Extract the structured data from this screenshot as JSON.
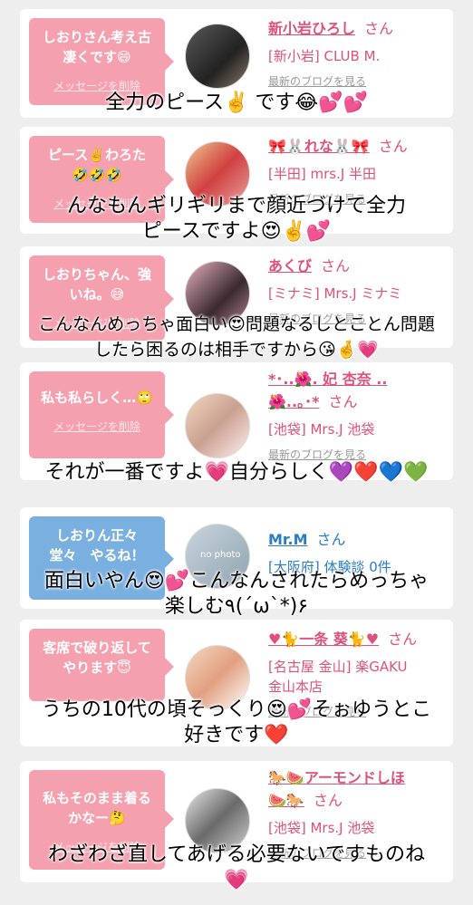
{
  "cards": [
    {
      "message": "しおりさん考え古\n凄くです😄",
      "delete_label": "メッセージを削除",
      "name": "新小岩ひろし",
      "san": "さん",
      "shop": "[新小岩] CLUB M.",
      "blog": "最新のブログを見る",
      "avatar": "avatar-photo"
    },
    {
      "message": "ピース✌️わろた\n🤣🤣🤣",
      "delete_label": "メッセージを削除",
      "name": "🎀🐰れな🐰🎀",
      "san": "さん",
      "shop": "[半田] mrs.J 半田",
      "blog": "最新のブログを見る",
      "avatar": "avatar-photo"
    },
    {
      "message": "しおりちゃん、強\nいね。😅",
      "delete_label": "メッセージを削除",
      "name": "あくび",
      "san": "さん",
      "shop": "[ミナミ] Mrs.J ミナミ",
      "blog": "最新のブログを見る",
      "avatar": "avatar-photo"
    },
    {
      "message": "私も私らしく…🙄",
      "delete_label": "メッセージを削除",
      "name": "*･..🌺. 妃 杏奈 ..\n🌺..｡･*",
      "san": "さん",
      "shop": "[池袋] Mrs.J 池袋",
      "blog": "最新のブログを見る",
      "avatar": "avatar-photo"
    },
    {
      "message": "しおりん正々\n堂々　やるね！",
      "delete_label": "",
      "name": "Mr.M",
      "san": "さん",
      "shop": "[大阪府] 体験談 0件",
      "blog": "",
      "avatar": "no photo"
    },
    {
      "message": "客席で破り返して\nやります😇",
      "delete_label": "",
      "name": "♥🐈一条 葵🐈♥",
      "san": "さん",
      "shop": "[名古屋 金山] 楽GAKU\n金山本店",
      "blog": "最新のブログを見る",
      "avatar": "avatar-photo"
    },
    {
      "message": "私もそのまま着る\nかなー🤔",
      "delete_label": "メッセージを削除",
      "name": "🐎🍉アーモンドしほ\n🍉🐎",
      "san": "さん",
      "shop": "[池袋] Mrs.J 池袋",
      "blog": "最新のブログを見る",
      "avatar": "avatar-photo"
    }
  ],
  "captions": [
    "全力のピース✌️ です😂💕💕",
    "んなもんギリギリまで顔近づけて全力\nピースですよ😍✌️💕",
    "こんなんめっちゃ面白い😍問題なるしとことん問題\nしたら困るのは相手ですから😘🤞💗",
    "それが一番ですよ💗自分らしく💜❤️💙💚",
    "面白いやん😍💕こんなんされたらめっちゃ\n楽しむ٩(´ω`*)۶",
    "うちの10代の頃そっくり😍💕そぉゆうとこ\n好きです❤️",
    "わざわざ直してあげる必要ないですものね\n💗"
  ]
}
